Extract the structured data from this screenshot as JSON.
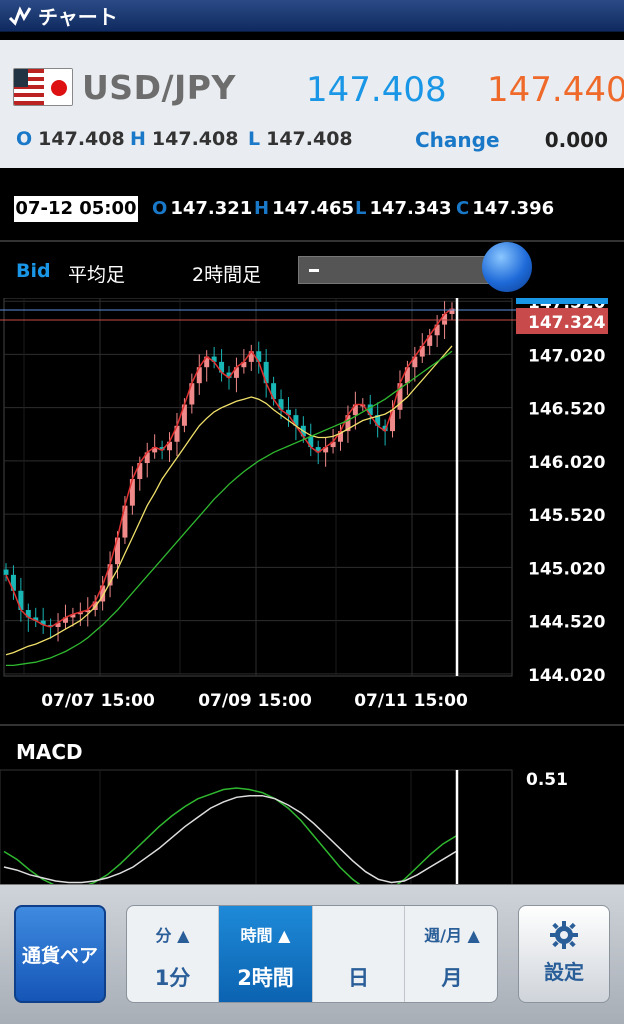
{
  "title": "チャート",
  "icons": {
    "app": "trend-line-icon",
    "flag": "usd-jpy-flag-icon",
    "settings": "gear-icon"
  },
  "quote": {
    "pair": "USD/JPY",
    "bid": "147.408",
    "ask": "147.440",
    "open_label": "O",
    "open": "147.408",
    "high_label": "H",
    "high": "147.408",
    "low_label": "L",
    "low": "147.408",
    "change_label": "Change",
    "change": "0.000"
  },
  "candle": {
    "datetime": "07-12 05:00",
    "o_label": "O",
    "o": "147.321",
    "h_label": "H",
    "h": "147.465",
    "l_label": "L",
    "l": "147.343",
    "c_label": "C",
    "c": "147.396"
  },
  "chart_toolbar": {
    "price_type": "Bid",
    "candle_type": "平均足",
    "timeframe": "2時間足"
  },
  "colors": {
    "bid": "#1a96e6",
    "ask": "#ef6a2a",
    "up": "#f08a8a",
    "down": "#19b6b6",
    "ma_short": "#f0e06a",
    "ma_long": "#2fb82f",
    "current_price_bg": "#c84a4a"
  },
  "chart_data": [
    {
      "type": "candlestick",
      "y_ticks": [
        "144.020",
        "144.520",
        "145.020",
        "145.520",
        "146.020",
        "146.520",
        "147.020",
        "147.520"
      ],
      "ylim": [
        144.0,
        147.55
      ],
      "x_ticks": [
        "07/07 15:00",
        "07/09 15:00",
        "07/11 15:00"
      ],
      "current_price_label": "147.324",
      "series": [
        {
          "values": [
            144.95,
            144.8,
            144.62,
            144.55,
            144.52,
            144.48,
            144.46,
            144.5,
            144.55,
            144.58,
            144.6,
            144.62,
            144.7,
            144.85,
            145.05,
            145.3,
            145.6,
            145.85,
            146.0,
            146.1,
            146.15,
            146.12,
            146.2,
            146.35,
            146.55,
            146.75,
            146.9,
            147.0,
            146.95,
            146.85,
            146.8,
            146.9,
            146.95,
            147.05,
            146.95,
            146.75,
            146.6,
            146.5,
            146.45,
            146.35,
            146.25,
            146.15,
            146.1,
            146.15,
            146.2,
            146.3,
            146.45,
            146.55,
            146.55,
            146.45,
            146.35,
            146.3,
            146.5,
            146.75,
            146.9,
            147.0,
            147.1,
            147.2,
            147.3,
            147.4,
            147.45
          ]
        },
        {
          "values": [
            144.2,
            144.22,
            144.25,
            144.28,
            144.3,
            144.33,
            144.36,
            144.4,
            144.44,
            144.48,
            144.52,
            144.58,
            144.65,
            144.75,
            144.88,
            145.0,
            145.15,
            145.3,
            145.45,
            145.6,
            145.72,
            145.85,
            145.95,
            146.05,
            146.15,
            146.25,
            146.35,
            146.42,
            146.48,
            146.52,
            146.55,
            146.58,
            146.6,
            146.62,
            146.6,
            146.56,
            146.5,
            146.45,
            146.4,
            146.35,
            146.3,
            146.26,
            146.24,
            146.24,
            146.25,
            146.28,
            146.32,
            146.36,
            146.4,
            146.42,
            146.44,
            146.46,
            146.5,
            146.56,
            146.62,
            146.7,
            146.78,
            146.86,
            146.94,
            147.02,
            147.1
          ]
        },
        {
          "values": [
            144.1,
            144.1,
            144.11,
            144.12,
            144.13,
            144.15,
            144.17,
            144.2,
            144.23,
            144.27,
            144.31,
            144.36,
            144.42,
            144.48,
            144.55,
            144.62,
            144.7,
            144.78,
            144.86,
            144.94,
            145.02,
            145.1,
            145.18,
            145.26,
            145.34,
            145.42,
            145.5,
            145.58,
            145.66,
            145.73,
            145.8,
            145.86,
            145.92,
            145.97,
            146.02,
            146.06,
            146.1,
            146.13,
            146.16,
            146.19,
            146.22,
            146.25,
            146.28,
            146.31,
            146.34,
            146.37,
            146.4,
            146.44,
            146.48,
            146.52,
            146.56,
            146.6,
            146.65,
            146.7,
            146.75,
            146.8,
            146.85,
            146.9,
            146.95,
            147.0,
            147.05
          ]
        }
      ]
    },
    {
      "type": "line",
      "title": "MACD",
      "y_max_label": "0.51",
      "series": [
        {
          "values": [
            0.1,
            0.05,
            -0.02,
            -0.08,
            -0.12,
            -0.14,
            -0.13,
            -0.1,
            -0.05,
            0.02,
            0.1,
            0.18,
            0.26,
            0.33,
            0.39,
            0.44,
            0.47,
            0.5,
            0.51,
            0.5,
            0.48,
            0.44,
            0.38,
            0.3,
            0.2,
            0.1,
            0.0,
            -0.08,
            -0.14,
            -0.16,
            -0.14,
            -0.08,
            0.0,
            0.08,
            0.15,
            0.2
          ]
        },
        {
          "values": [
            0.0,
            -0.02,
            -0.05,
            -0.07,
            -0.09,
            -0.1,
            -0.1,
            -0.09,
            -0.07,
            -0.04,
            0.0,
            0.06,
            0.12,
            0.19,
            0.26,
            0.32,
            0.38,
            0.42,
            0.45,
            0.46,
            0.46,
            0.44,
            0.4,
            0.35,
            0.28,
            0.2,
            0.12,
            0.04,
            -0.03,
            -0.08,
            -0.1,
            -0.09,
            -0.05,
            0.0,
            0.05,
            0.1
          ]
        }
      ]
    }
  ],
  "bottom_bar": {
    "pair_button": "通貨ペア",
    "tf_groups": [
      {
        "top": "分 ▲",
        "bottom": "1分"
      },
      {
        "top": "時間 ▲",
        "bottom": "2時間"
      },
      {
        "top": "",
        "bottom": "日"
      },
      {
        "top": "週/月 ▲",
        "bottom": "月"
      }
    ],
    "settings": "設定"
  }
}
